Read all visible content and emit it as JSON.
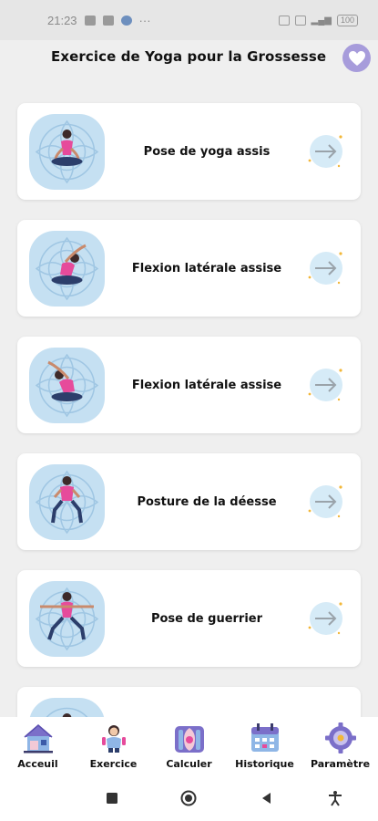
{
  "status_bar": {
    "time": "21:23",
    "battery": "100"
  },
  "header": {
    "title": "Exercice de Yoga pour la Grossesse"
  },
  "cards": [
    {
      "label": "Pose de yoga assis"
    },
    {
      "label": "Flexion latérale assise"
    },
    {
      "label": "Flexion latérale assise"
    },
    {
      "label": "Posture de la déesse"
    },
    {
      "label": "Pose de guerrier"
    },
    {
      "label": ""
    }
  ],
  "bottom_nav": [
    {
      "label": "Acceuil",
      "icon": "home-icon"
    },
    {
      "label": "Exercice",
      "icon": "exercise-icon"
    },
    {
      "label": "Calculer",
      "icon": "calculator-icon"
    },
    {
      "label": "Historique",
      "icon": "calendar-icon"
    },
    {
      "label": "Paramètre",
      "icon": "settings-icon"
    }
  ],
  "colors": {
    "accent_purple": "#a79cdb",
    "thumb_bg": "#c5e0f2",
    "figure_pink": "#e64b9b",
    "arrow_circle": "#d6ebf7",
    "sparkle_yellow": "#f2b739"
  }
}
